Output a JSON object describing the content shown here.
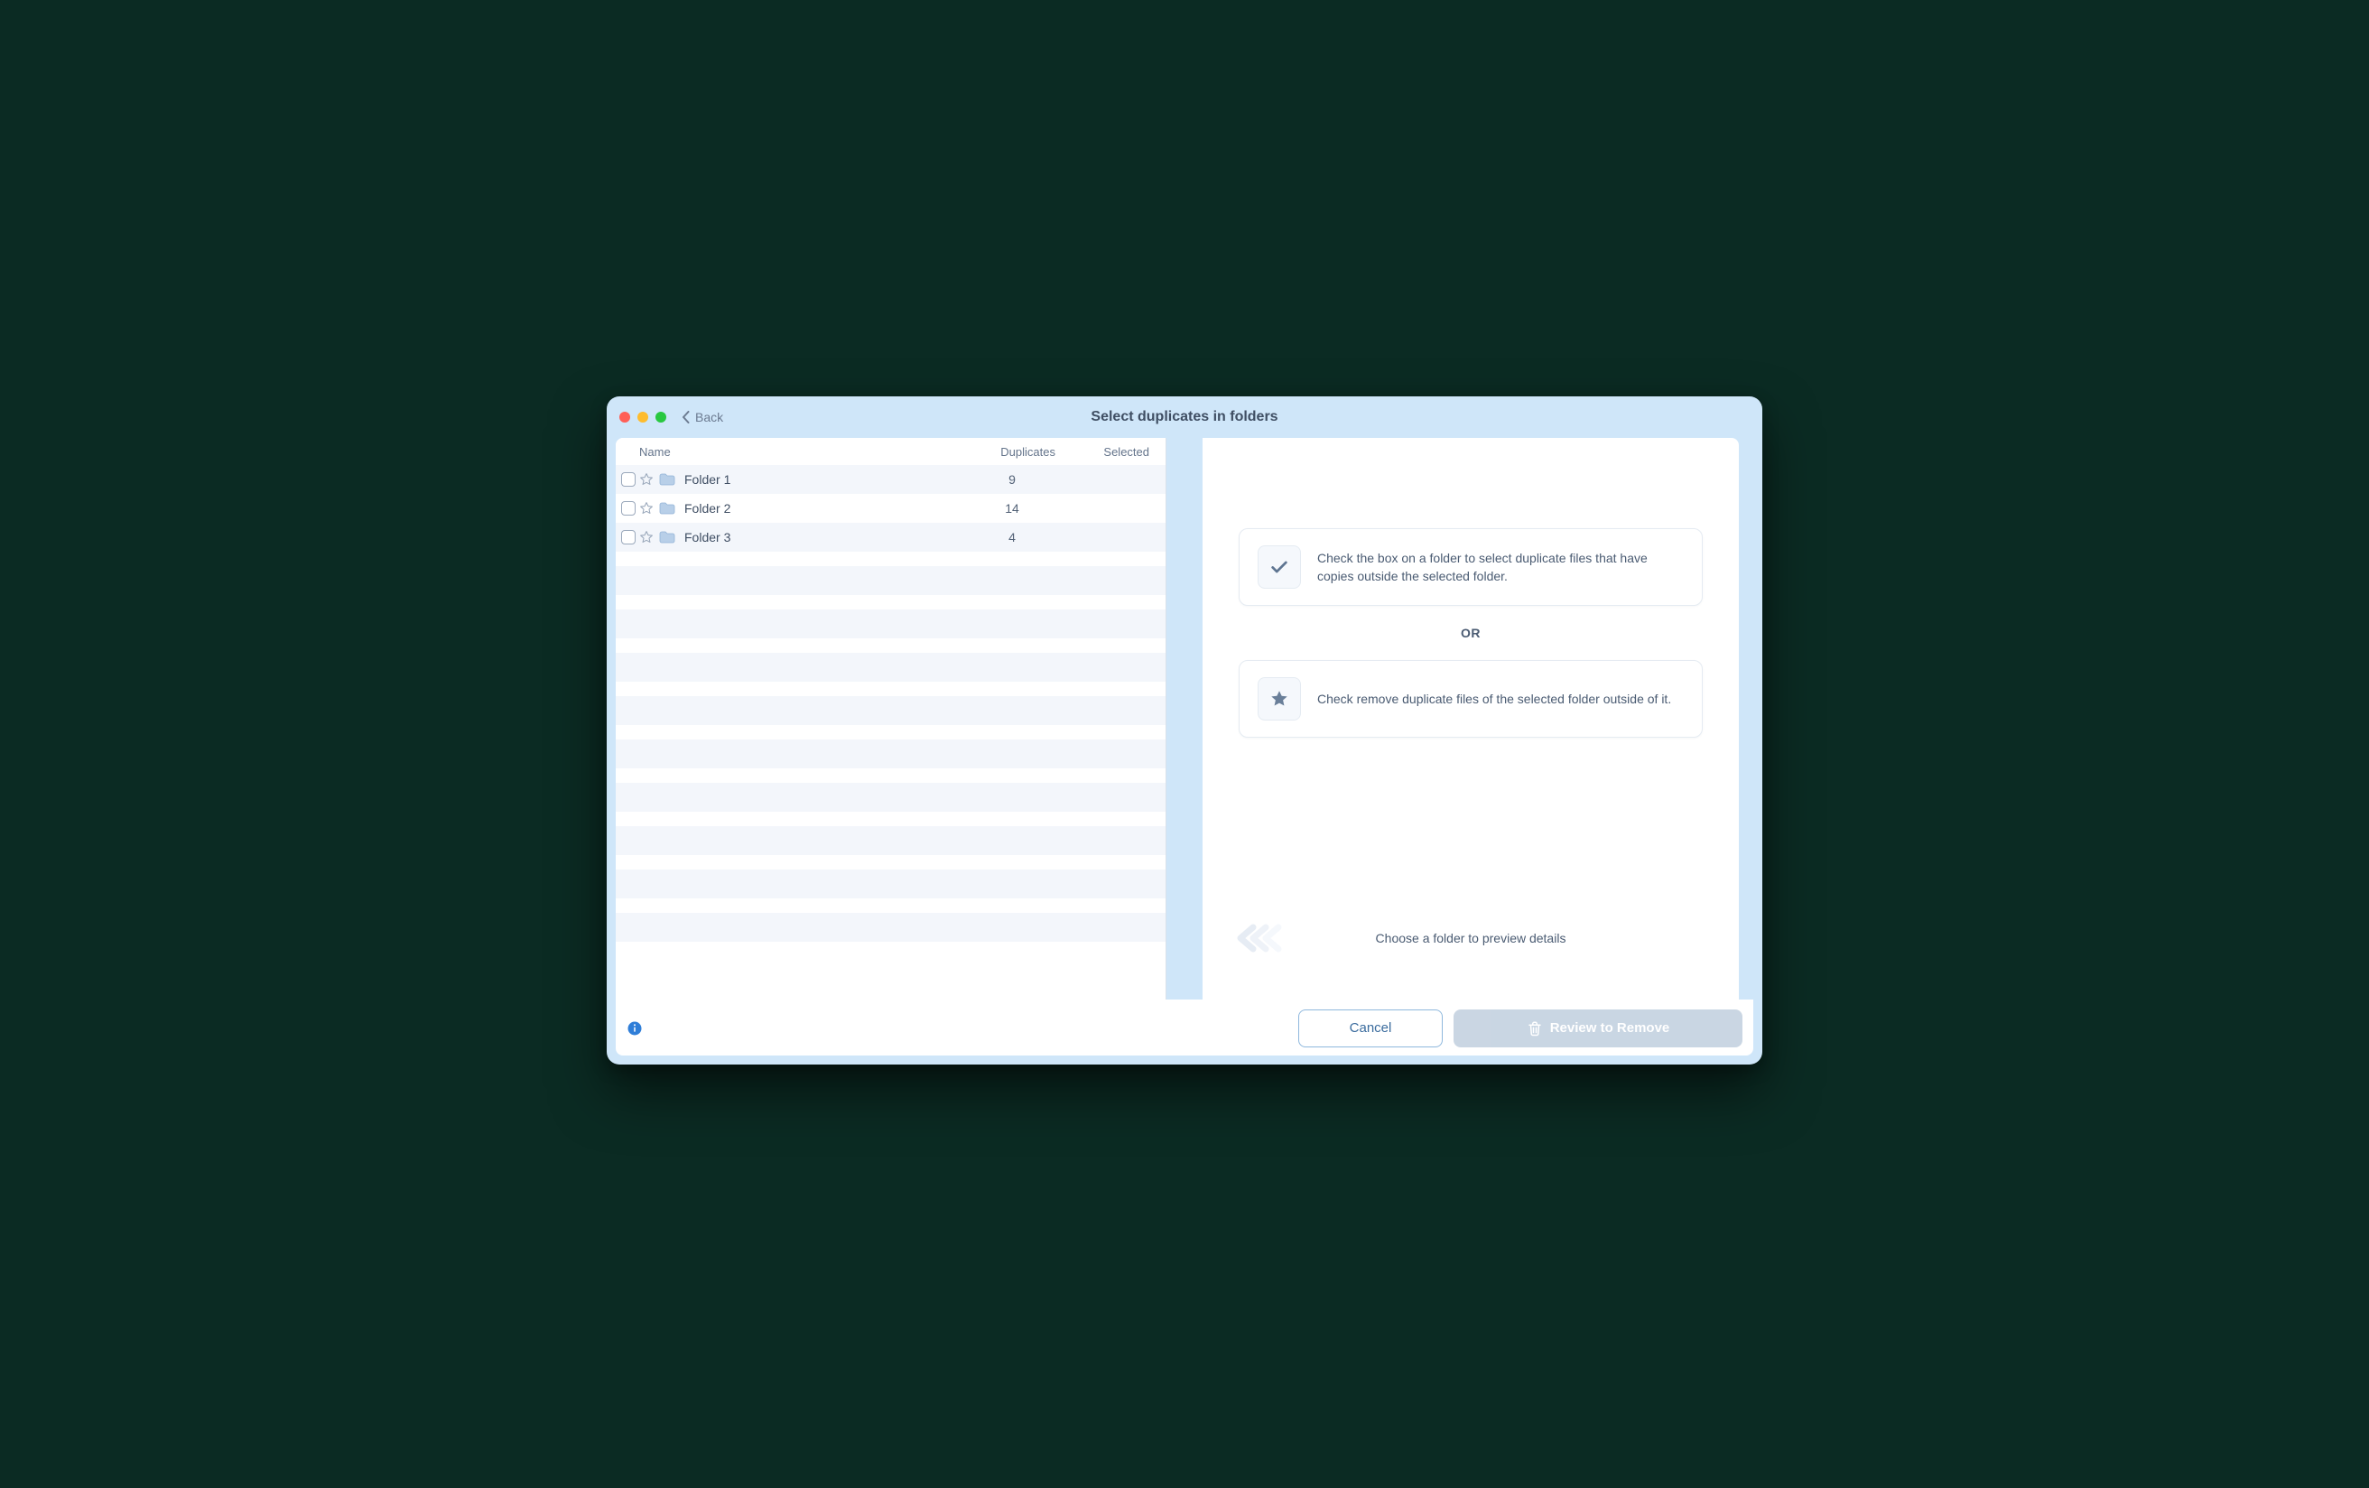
{
  "titlebar": {
    "back_label": "Back",
    "title": "Select duplicates in folders"
  },
  "columns": {
    "name": "Name",
    "duplicates": "Duplicates",
    "selected": "Selected"
  },
  "folders": [
    {
      "name": "Folder 1",
      "duplicates": "9",
      "selected": ""
    },
    {
      "name": "Folder 2",
      "duplicates": "14",
      "selected": ""
    },
    {
      "name": "Folder 3",
      "duplicates": "4",
      "selected": ""
    }
  ],
  "tips": {
    "check": "Check the box on a folder to select duplicate files that have copies outside the selected folder.",
    "or": "OR",
    "star": "Check remove duplicate files of the selected folder outside of it."
  },
  "preview": {
    "message": "Choose a folder to preview details"
  },
  "footer": {
    "cancel": "Cancel",
    "review": "Review to Remove"
  },
  "icons": {
    "back": "chevron-left-icon",
    "folder": "folder-icon",
    "check": "check-icon",
    "star": "star-icon",
    "trash": "trash-icon",
    "info": "info-icon"
  },
  "colors": {
    "accent_blue": "#2f7ed8",
    "window_bg": "#cfe6f9"
  }
}
